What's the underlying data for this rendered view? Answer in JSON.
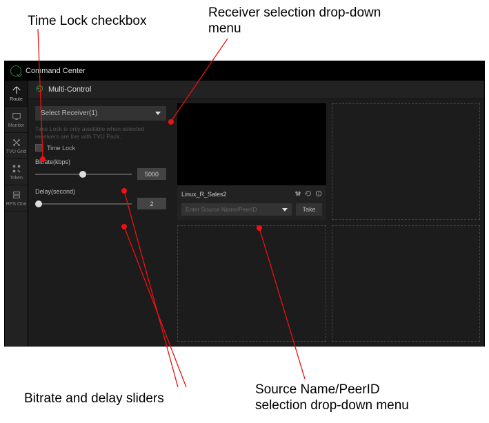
{
  "annotations": {
    "timelock": "Time Lock checkbox",
    "receiver": "Receiver selection drop-down menu",
    "sliders": "Bitrate and delay sliders",
    "source": "Source Name/PeerID selection drop-down menu"
  },
  "app": {
    "title": "Command Center",
    "topbar_title": "Multi-Control"
  },
  "sidebar": {
    "items": [
      {
        "label": "Route"
      },
      {
        "label": "Monitor"
      },
      {
        "label": "TVU Grid"
      },
      {
        "label": "Token"
      },
      {
        "label": "RPS One"
      }
    ]
  },
  "panel": {
    "receiver_dropdown": "Select Receiver(1)",
    "hint": "Time Lock is only available when selected receivers are live with TVU Pack.",
    "timelock_label": "Time Lock",
    "bitrate_label": "Bitrate(kbps)",
    "bitrate_value": "5000",
    "delay_label": "Delay(second)",
    "delay_value": "2"
  },
  "tile": {
    "title": "Linux_R_Sales2",
    "source_placeholder": "Enter Source Name/PeerID",
    "take_label": "Take"
  }
}
